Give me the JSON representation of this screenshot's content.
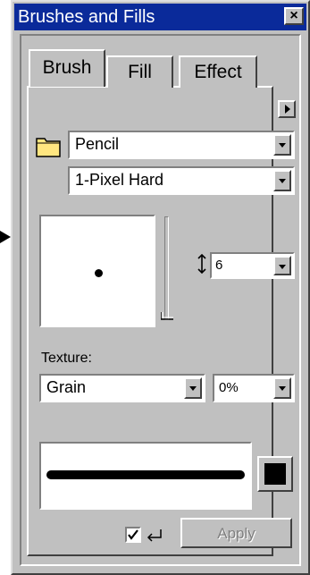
{
  "window": {
    "title": "Brushes and Fills",
    "close_label": "×"
  },
  "tabs": [
    {
      "label": "Brush",
      "active": true
    },
    {
      "label": "Fill",
      "active": false
    },
    {
      "label": "Effect",
      "active": false
    }
  ],
  "brush": {
    "category": "Pencil",
    "variant": "1-Pixel Hard",
    "size": "6",
    "texture_label": "Texture:",
    "texture": "Grain",
    "opacity": "0%",
    "apply_label": "Apply",
    "preview_checked": true,
    "color": "#000000"
  },
  "icons": {
    "folder": "folder-icon",
    "menu": "menu-arrow-icon",
    "size_arrows": "vertical-resize-icon",
    "return": "return-arrow-icon"
  },
  "colors": {
    "titlebar": "#0a2a9a",
    "panel": "#c0c0c0"
  }
}
